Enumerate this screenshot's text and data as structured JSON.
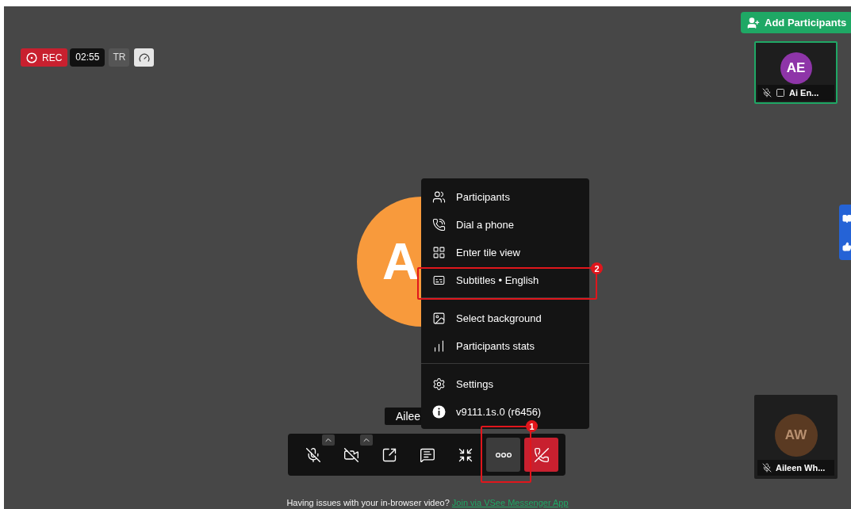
{
  "recording": {
    "label": "REC",
    "time": "02:55",
    "badge": "TR"
  },
  "add_participants": {
    "label": "Add Participants"
  },
  "main_speaker": {
    "initials": "A",
    "name": "Ailee"
  },
  "tiles": [
    {
      "initials": "AE",
      "name": "Ai En...",
      "color": "#8e35a8",
      "active": true,
      "moderator": true
    },
    {
      "initials": "AW",
      "name": "Aileen Wh...",
      "color": "#5a3a22",
      "active": false,
      "moderator": false
    }
  ],
  "menu": {
    "groups": [
      [
        {
          "label": "Participants"
        },
        {
          "label": "Dial a phone"
        },
        {
          "label": "Enter tile view"
        },
        {
          "label": "Subtitles • English",
          "annotation": "2"
        }
      ],
      [
        {
          "label": "Select background"
        },
        {
          "label": "Participants stats"
        }
      ],
      [
        {
          "label": "Settings"
        },
        {
          "label": "v9111.1s.0 (r6456)"
        }
      ]
    ]
  },
  "toolbar": [
    {
      "kind": "toggle",
      "has_menu": true,
      "selected": false
    },
    {
      "kind": "toggle",
      "has_menu": true,
      "selected": false
    },
    {
      "kind": "toggle",
      "has_menu": false,
      "selected": false
    },
    {
      "kind": "toggle",
      "has_menu": false,
      "selected": false
    },
    {
      "kind": "toggle",
      "has_menu": false,
      "selected": false
    },
    {
      "kind": "toggle",
      "has_menu": false,
      "selected": true,
      "annotation": "1"
    },
    {
      "kind": "hangup",
      "has_menu": false,
      "selected": false
    }
  ],
  "footer": {
    "text": "Having issues with your in-browser video?",
    "link": "Join via VSee Messenger App"
  }
}
